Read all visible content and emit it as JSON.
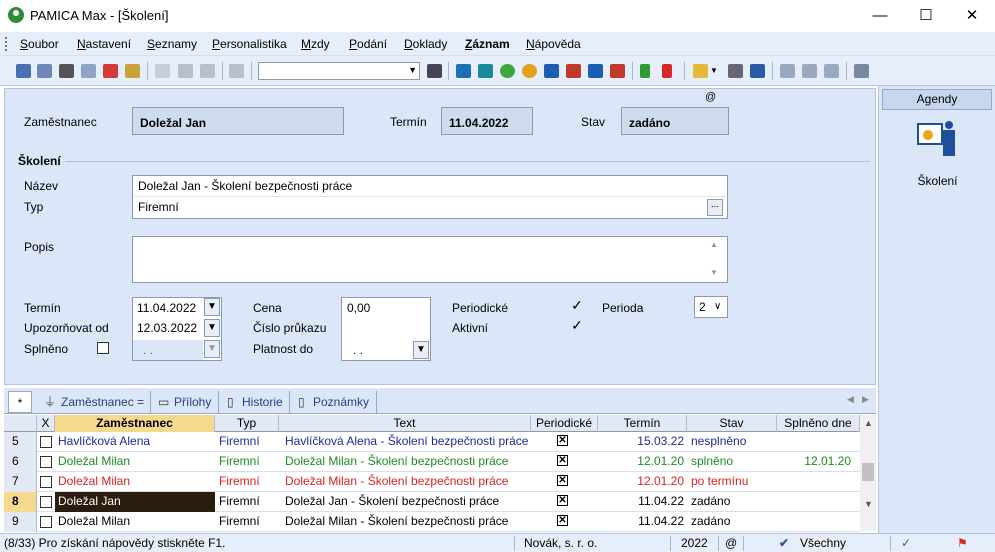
{
  "window": {
    "title": "PAMICA Max - [Školení]",
    "minimize": "—",
    "maximize": "☐",
    "close": "✕"
  },
  "menu": {
    "items": [
      "Soubor",
      "Nastavení",
      "Seznamy",
      "Personalistika",
      "Mzdy",
      "Podání",
      "Doklady",
      "Záznam",
      "Nápověda"
    ],
    "active": "Záznam"
  },
  "header": {
    "employee_label": "Zaměstnanec",
    "employee_value": "Doležal Jan",
    "term_label": "Termín",
    "term_value": "11.04.2022",
    "state_label": "Stav",
    "state_value": "zadáno",
    "at_symbol": "@"
  },
  "section": {
    "title": "Školení"
  },
  "fields": {
    "name_label": "Název",
    "name_value": "Doležal Jan - Školení bezpečnosti práce",
    "type_label": "Typ",
    "type_value": "Firemní",
    "type_button": "...",
    "desc_label": "Popis",
    "desc_value": "",
    "term_label": "Termín",
    "term_value": "11.04.2022",
    "notify_label": "Upozorňovat od",
    "notify_value": "12.03.2022",
    "done_label": "Splněno",
    "done_value": ". .",
    "price_label": "Cena",
    "price_value": "0,00",
    "card_label": "Číslo průkazu",
    "card_value": "",
    "valid_label": "Platnost do",
    "valid_value": ". .",
    "periodic_label": "Periodické",
    "periodic_checked": true,
    "active_label": "Aktivní",
    "active_checked": true,
    "period_label": "Perioda",
    "period_value": "2"
  },
  "sidebar": {
    "header": "Agendy",
    "item_label": "Školení"
  },
  "tabs": {
    "star": "*",
    "items": [
      "Zaměstnanec =",
      "Přílohy",
      "Historie",
      "Poznámky"
    ]
  },
  "grid": {
    "columns": [
      "X",
      "Zaměstnanec",
      "Typ",
      "Text",
      "Periodické",
      "Termín",
      "Stav",
      "Splněno dne"
    ],
    "rows": [
      {
        "n": "5",
        "emp": "Havlíčková Alena",
        "typ": "Firemní",
        "text": "Havlíčková Alena - Školení bezpečnosti práce",
        "term": "15.03.22",
        "stav": "nesplněno",
        "done": "",
        "color": "#1c2a9a"
      },
      {
        "n": "6",
        "emp": "Doležal Milan",
        "typ": "Firemní",
        "text": "Doležal Milan - Školení bezpečnosti práce",
        "term": "12.01.20",
        "stav": "splněno",
        "done": "12.01.20",
        "color": "#1f8a1f"
      },
      {
        "n": "7",
        "emp": "Doležal Milan",
        "typ": "Firemní",
        "text": "Doležal Milan - Školení bezpečnosti práce",
        "term": "12.01.20",
        "stav": "po termínu",
        "done": "",
        "color": "#e02020"
      },
      {
        "n": "8",
        "emp": "Doležal Jan",
        "typ": "Firemní",
        "text": "Doležal Jan - Školení bezpečnosti práce",
        "term": "11.04.22",
        "stav": "zadáno",
        "done": "",
        "color": "#000000"
      },
      {
        "n": "9",
        "emp": "Doležal Milan",
        "typ": "Firemní",
        "text": "Doležal Milan - Školení bezpečnosti práce",
        "term": "11.04.22",
        "stav": "zadáno",
        "done": "",
        "color": "#000000"
      }
    ]
  },
  "status": {
    "hint": "(8/33) Pro získání nápovědy stiskněte F1.",
    "company": "Novák, s. r. o.",
    "year": "2022",
    "at": "@",
    "filter": "Všechny"
  },
  "colors": {
    "accent": "#dbe7f8",
    "selected_row": "#2b1d0e",
    "header_col": "#f5d98c"
  }
}
